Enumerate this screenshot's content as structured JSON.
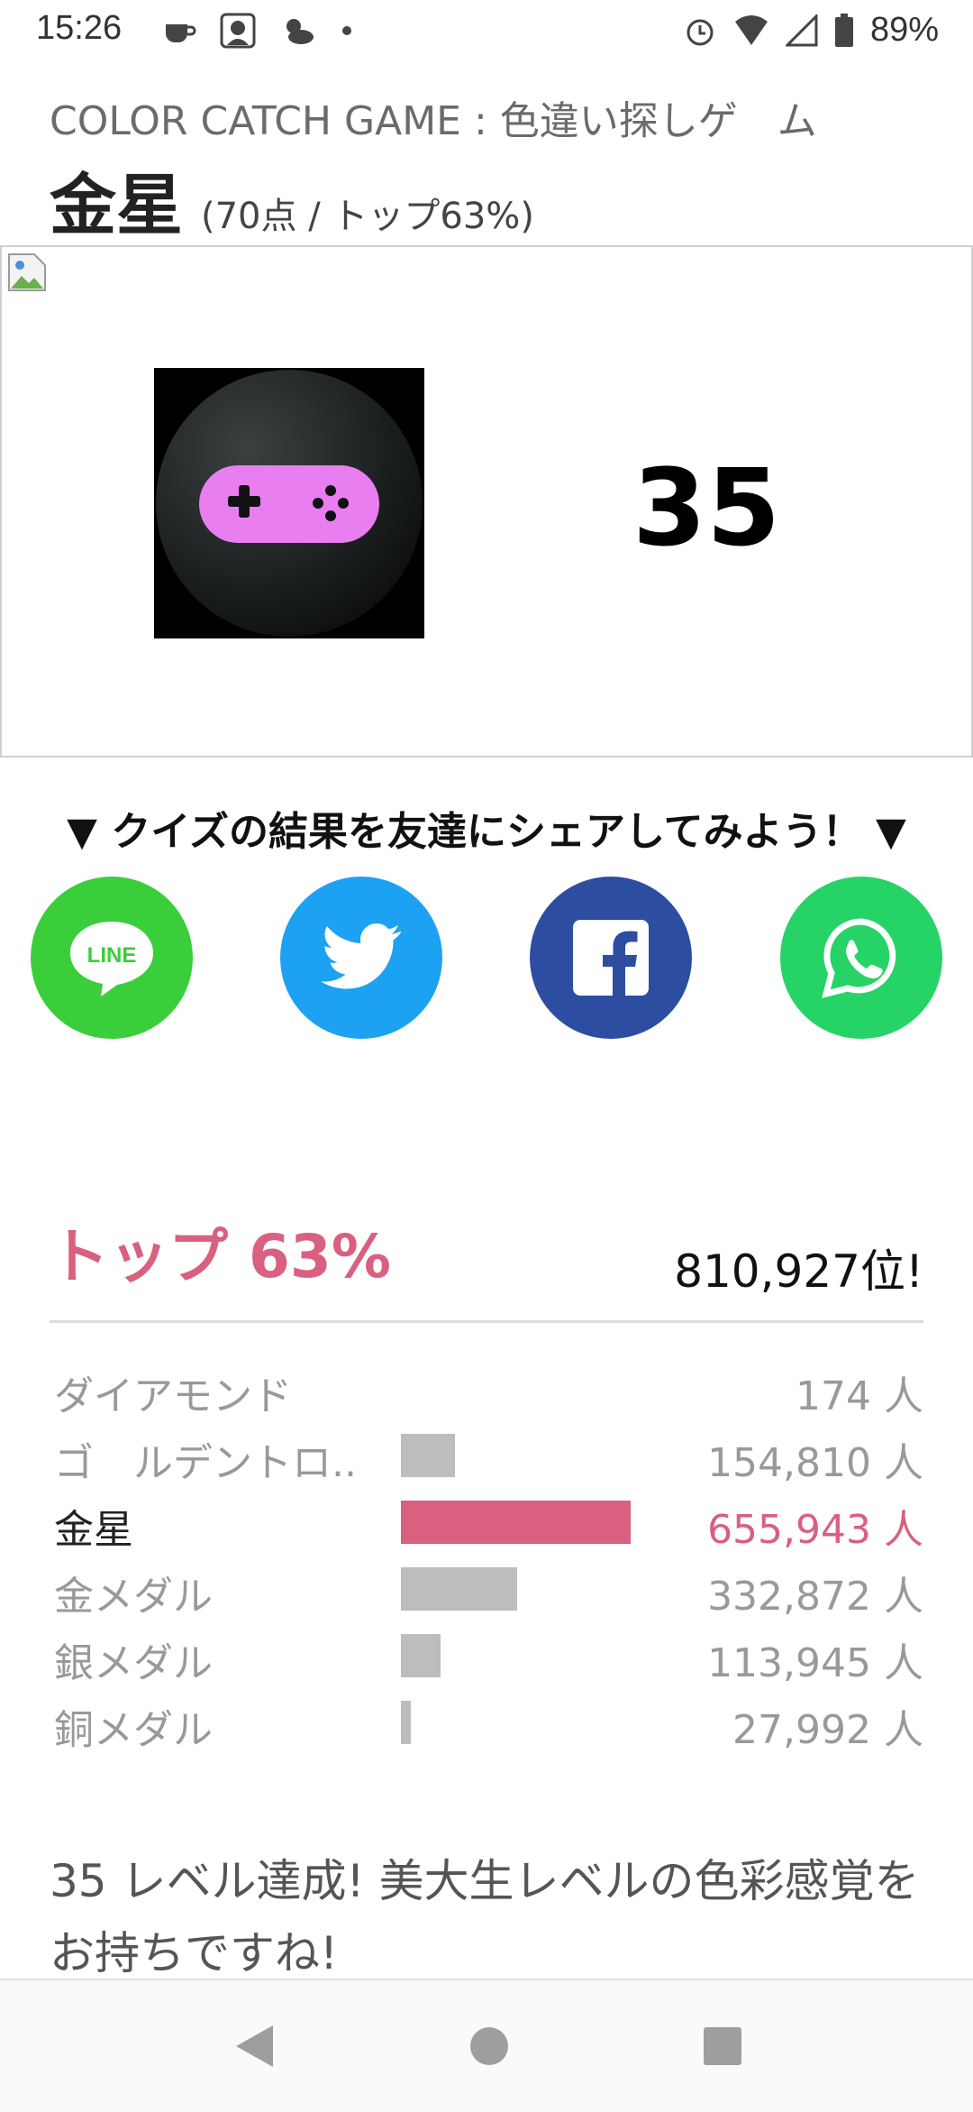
{
  "status_bar": {
    "time": "15:26",
    "battery": "89%",
    "icons_left": [
      "coffee-icon",
      "avatar-icon",
      "weather-icon",
      "dot-icon"
    ],
    "icons_right": [
      "alarm-icon",
      "wifi-icon",
      "signal-icon",
      "battery-icon"
    ]
  },
  "header": {
    "subtitle": "COLOR CATCH GAME : 色違い探しゲ　ム",
    "badge_name": "金星",
    "score_text": "(70点 / トップ63%)"
  },
  "result": {
    "level": "35",
    "game_icon_color": "#e97ef0"
  },
  "share": {
    "heading": "▼ クイズの結果を友達にシェアしてみよう！ ▼",
    "buttons": [
      {
        "name": "line",
        "label": "LINE",
        "color": "#3ace3a"
      },
      {
        "name": "twitter",
        "label": "",
        "color": "#1da1f2"
      },
      {
        "name": "facebook",
        "label": "f",
        "color": "#2d4da1"
      },
      {
        "name": "whatsapp",
        "label": "",
        "color": "#26d366"
      }
    ]
  },
  "ranking": {
    "top_label": "トップ 63%",
    "position": "810,927位!",
    "accent_color": "#d9607f",
    "rows": [
      {
        "label": "ダイアモンド",
        "count": "174 人",
        "fraction": 0.0,
        "current": false
      },
      {
        "label": "ゴ　ルデントロ...",
        "count": "154,810 人",
        "fraction": 0.236,
        "current": false
      },
      {
        "label": "金星",
        "count": "655,943 人",
        "fraction": 1.0,
        "current": true
      },
      {
        "label": "金メダル",
        "count": "332,872 人",
        "fraction": 0.507,
        "current": false
      },
      {
        "label": "銀メダル",
        "count": "113,945 人",
        "fraction": 0.174,
        "current": false
      },
      {
        "label": "銅メダル",
        "count": "27,992 人",
        "fraction": 0.043,
        "current": false
      }
    ]
  },
  "message": "35 レベル達成! 美大生レベルの色彩感覚をお持ちですね!"
}
